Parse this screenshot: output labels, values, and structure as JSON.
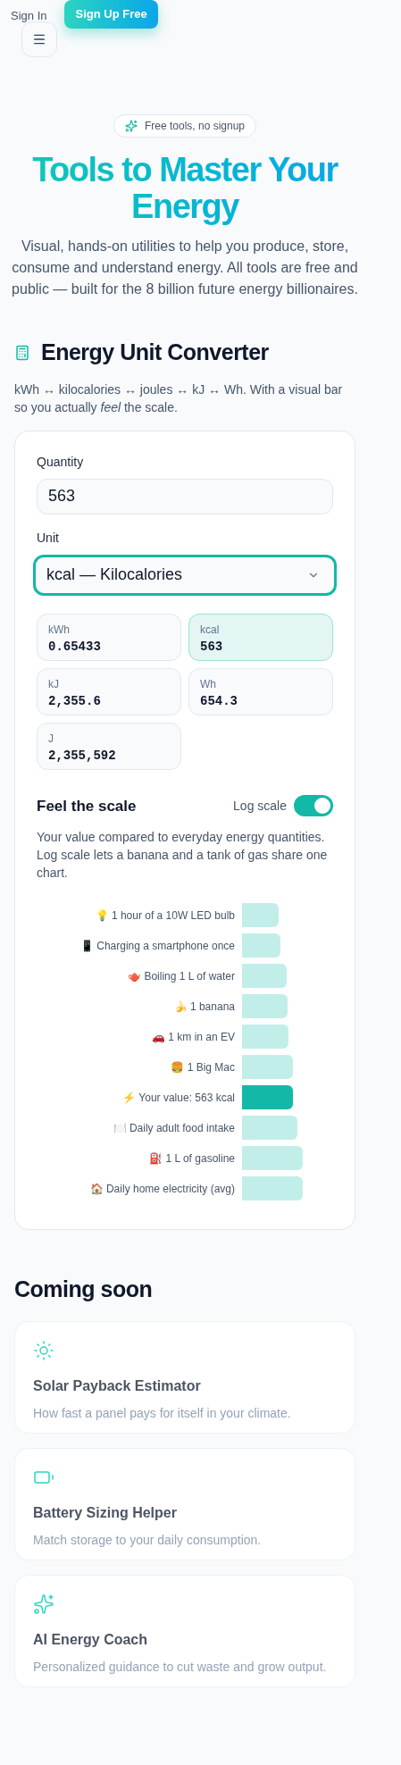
{
  "header": {
    "sign_in": "Sign In",
    "sign_up": "Sign Up Free"
  },
  "hero": {
    "badge": "Free tools, no signup",
    "title": "Tools to Master Your Energy",
    "subtitle": "Visual, hands-on utilities to help you produce, store, consume and understand energy. All tools are free and public — built for the 8 billion future energy billionaires."
  },
  "converter": {
    "title": "Energy Unit Converter",
    "description": "kWh ↔ kilocalories ↔ joules ↔ kJ ↔ Wh. With a visual bar so you actually *feel* the scale.",
    "quantity": {
      "label": "Quantity",
      "value": "563"
    },
    "unit": {
      "label": "Unit",
      "value": "kcal — Kilocalories"
    },
    "results": [
      {
        "unit": "kWh",
        "value": "0.65433",
        "selected": false
      },
      {
        "unit": "kcal",
        "value": "563",
        "selected": true
      },
      {
        "unit": "kJ",
        "value": "2,355.6",
        "selected": false
      },
      {
        "unit": "Wh",
        "value": "654.3",
        "selected": false
      },
      {
        "unit": "J",
        "value": "2,355,592",
        "selected": false
      }
    ],
    "scale": {
      "title": "Feel the scale",
      "toggle_label": "Log scale",
      "log_scale": true,
      "description": "Your value compared to everyday energy quantities. Log scale lets a banana and a tank of gas share one chart.",
      "rows": [
        {
          "emoji": "💡",
          "label": "1 hour of a 10W LED bulb",
          "selected": false
        },
        {
          "emoji": "📱",
          "label": "Charging a smartphone once",
          "selected": false
        },
        {
          "emoji": "🫖",
          "label": "Boiling 1 L of water",
          "selected": false
        },
        {
          "emoji": "🍌",
          "label": "1 banana",
          "selected": false
        },
        {
          "emoji": "🚗",
          "label": "1 km in an EV",
          "selected": false
        },
        {
          "emoji": "🍔",
          "label": "1 Big Mac",
          "selected": false
        },
        {
          "emoji": "⚡",
          "label": "Your value: 563 kcal",
          "selected": true
        },
        {
          "emoji": "🍽️",
          "label": "Daily adult food intake",
          "selected": false
        },
        {
          "emoji": "⛽",
          "label": "1 L of gasoline",
          "selected": false
        },
        {
          "emoji": "🏠",
          "label": "Daily home electricity (avg)",
          "selected": false
        }
      ]
    }
  },
  "coming_soon": {
    "title": "Coming soon",
    "tools": [
      {
        "kind": "sun",
        "name": "Solar Payback Estimator",
        "description": "How fast a panel pays for itself in your climate."
      },
      {
        "kind": "battery",
        "name": "Battery Sizing Helper",
        "description": "Match storage to your daily consumption."
      },
      {
        "kind": "sparkles",
        "name": "AI Energy Coach",
        "description": "Personalized guidance to cut waste and grow output."
      }
    ]
  }
}
